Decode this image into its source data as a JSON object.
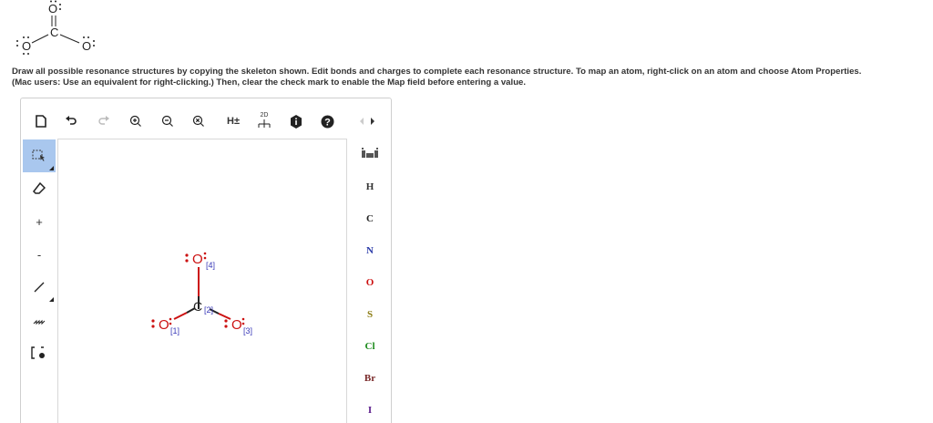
{
  "skeleton": {
    "atoms": {
      "top": "O",
      "center": "C",
      "left": "O",
      "right": "O"
    },
    "colors": {
      "ink": "#222222"
    }
  },
  "prompt": {
    "line1": "Draw all possible resonance structures by copying the skeleton shown. Edit bonds and charges to complete each resonance structure. To map an atom, right-click on an atom and choose Atom Properties.",
    "line2": "(Mac users: Use an equivalent for right-clicking.) Then, clear the check mark to enable the Map field before entering a value."
  },
  "toolbar": {
    "buttons": [
      {
        "name": "new-document-icon"
      },
      {
        "name": "undo-icon"
      },
      {
        "name": "redo-icon"
      },
      {
        "name": "zoom-in-icon"
      },
      {
        "name": "zoom-out-icon"
      },
      {
        "name": "zoom-reset-icon"
      },
      {
        "name": "hydrogen-toggle",
        "label": "H±"
      },
      {
        "name": "clean-2d-icon",
        "label": "2D"
      },
      {
        "name": "info-icon"
      },
      {
        "name": "help-icon"
      },
      {
        "name": "nav-arrows"
      }
    ]
  },
  "left_tools": [
    {
      "name": "select-tool-icon",
      "active": true
    },
    {
      "name": "eraser-tool-icon"
    },
    {
      "name": "charge-plus-tool",
      "label": "+"
    },
    {
      "name": "charge-minus-tool",
      "label": "-"
    },
    {
      "name": "single-bond-tool-icon"
    },
    {
      "name": "chain-tool-icon"
    },
    {
      "name": "bracket-tool-icon"
    }
  ],
  "canvas": {
    "atoms": [
      {
        "symbol": "O",
        "map": "[4]",
        "color": "#cc1111"
      },
      {
        "symbol": "C",
        "map": "[2]",
        "color": "#222222"
      },
      {
        "symbol": "O",
        "map": "[1]",
        "color": "#cc1111"
      },
      {
        "symbol": "O",
        "map": "[3]",
        "color": "#cc1111"
      }
    ],
    "map_color": "#3a3ab8"
  },
  "elements": [
    {
      "symbol": "periodic-table-icon",
      "color": "#444444"
    },
    {
      "symbol": "H",
      "color": "#333333"
    },
    {
      "symbol": "C",
      "color": "#222222"
    },
    {
      "symbol": "N",
      "color": "#2a3aa8"
    },
    {
      "symbol": "O",
      "color": "#cc1111"
    },
    {
      "symbol": "S",
      "color": "#8a7a10"
    },
    {
      "symbol": "Cl",
      "color": "#1a8a1a"
    },
    {
      "symbol": "Br",
      "color": "#7a2a2a"
    },
    {
      "symbol": "I",
      "color": "#5a1a8a"
    }
  ]
}
